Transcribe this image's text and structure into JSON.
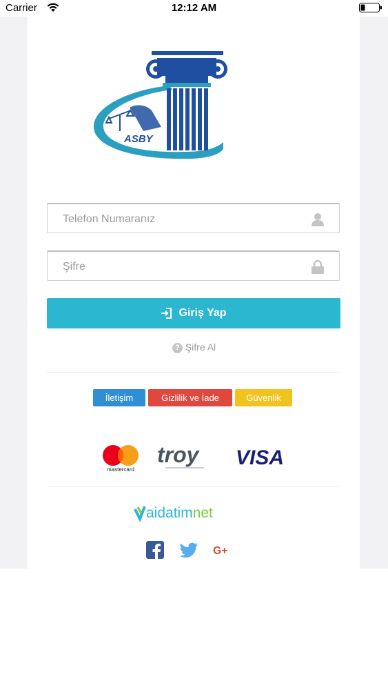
{
  "status_bar": {
    "carrier": "Carrier",
    "time": "12:12 AM"
  },
  "logo": {
    "text": "ASBY"
  },
  "login_form": {
    "phone_placeholder": "Telefon Numaranız",
    "password_placeholder": "Şifre",
    "login_label": "Giriş Yap",
    "forgot_label": "Şifre Al"
  },
  "links": {
    "contact": "İletişim",
    "privacy": "Gizlilik ve İade",
    "security": "Güvenlik"
  },
  "payment": {
    "mastercard_text": "mastercard",
    "troy_text": "troy",
    "visa_text": "VISA"
  },
  "brand": {
    "prefix": "aidatim",
    "suffix": "net"
  },
  "colors": {
    "primary": "#2bb7d0",
    "contact": "#2f8ed6",
    "privacy": "#e0483e",
    "security": "#f1c31f",
    "logo_blue": "#1f4fa0",
    "logo_teal": "#2a9fc0"
  },
  "icons": {
    "user": "user-icon",
    "lock": "lock-icon",
    "login": "sign-in-icon",
    "question": "question-circle-icon",
    "facebook": "facebook-icon",
    "twitter": "twitter-icon",
    "google_plus": "google-plus-icon"
  }
}
